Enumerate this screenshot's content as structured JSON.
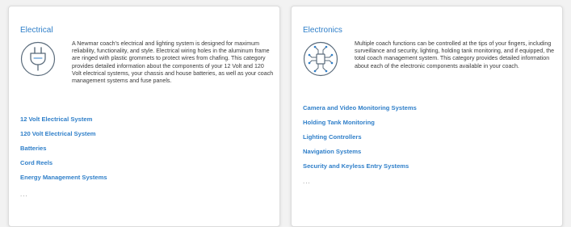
{
  "cards": [
    {
      "title": "Electrical",
      "icon": "power-plug-icon",
      "description": "A Newmar coach's electrical and lighting system is designed for maximum reliability, functionality, and style. Electrical wiring holes in the aluminum frame are ringed with plastic grommets to protect wires from chafing. This category provides detailed information about the components of your 12 Volt and 120 Volt electrical systems, your chassis and house batteries, as well as your coach management systems and fuse panels.",
      "links": [
        "12 Volt Electrical System",
        "120 Volt Electrical System",
        "Batteries",
        "Cord Reels",
        "Energy Management Systems"
      ],
      "more": "..."
    },
    {
      "title": "Electronics",
      "icon": "circuit-icon",
      "description": "Multiple coach functions can be controlled at the tips of your fingers, including surveillance and security, lighting, holding tank monitoring, and if equipped, the total coach management system. This category provides detailed information about each of the electronic components available in your coach.",
      "links": [
        "Camera and Video Monitoring Systems",
        "Holding Tank Monitoring",
        "Lighting Controllers",
        "Navigation Systems",
        "Security and Keyless Entry Systems"
      ],
      "more": "..."
    }
  ],
  "colors": {
    "accent": "#2f7fc9",
    "text": "#3a3a3a",
    "card_background": "#ffffff",
    "page_background": "#f2f2f2",
    "muted": "#8a8a8a"
  }
}
